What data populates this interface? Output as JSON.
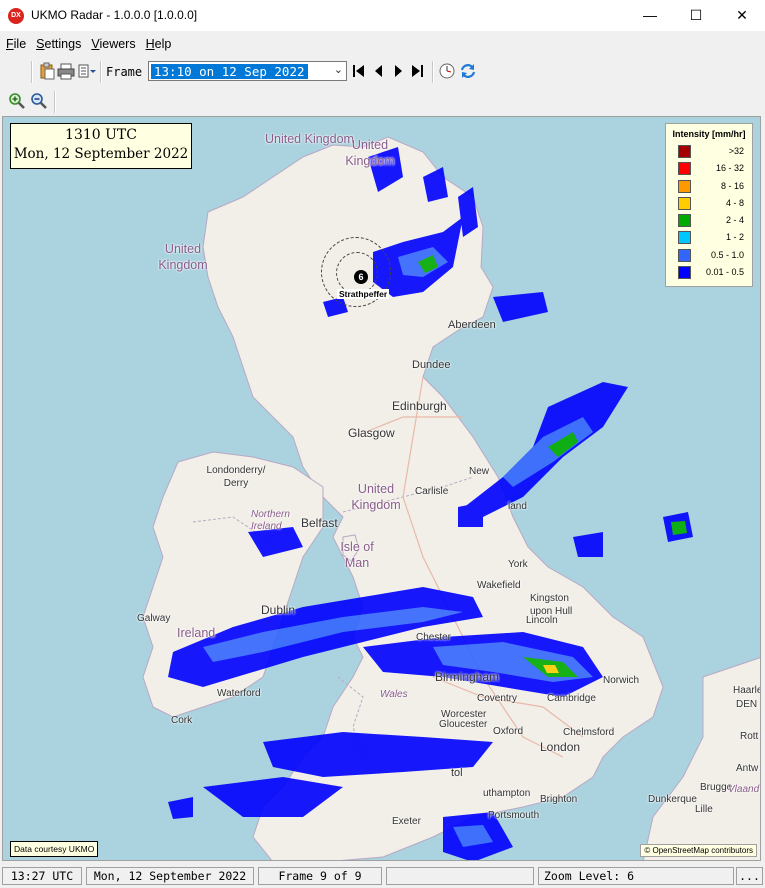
{
  "window": {
    "title": "UKMO Radar - 1.0.0.0 [1.0.0.0]",
    "icon_text": "DX",
    "minimize": "—",
    "maximize": "☐",
    "close": "✕"
  },
  "menu": [
    "File",
    "Settings",
    "Viewers",
    "Help"
  ],
  "toolbar": {
    "frame_label": "Frame",
    "frame_value": "13:10 on 12 Sep 2022"
  },
  "map": {
    "time_utc": "1310 UTC",
    "date_long": "Mon, 12 September 2022",
    "legend_title": "Intensity [mm/hr]",
    "legend": [
      {
        "label": ">32",
        "color": "#a50000"
      },
      {
        "label": "16 - 32",
        "color": "#ff0000"
      },
      {
        "label": "8 - 16",
        "color": "#ff9900"
      },
      {
        "label": "4 - 8",
        "color": "#ffcc00"
      },
      {
        "label": "2 - 4",
        "color": "#00aa00"
      },
      {
        "label": "1 - 2",
        "color": "#00c8ff"
      },
      {
        "label": "0.5 - 1.0",
        "color": "#3366ff"
      },
      {
        "label": "0.01 - 0.5",
        "color": "#0000ff"
      }
    ],
    "radar_site_number": "6",
    "radar_site_name": "Strathpeffer",
    "credit_left": "Data courtesy UKMO",
    "credit_right": "© OpenStreetMap contributors",
    "places": {
      "uk1": "United Kingdom",
      "uk2": "United Kingdom",
      "uk3": "United Kingdom",
      "aberdeen": "Aberdeen",
      "dundee": "Dundee",
      "edinburgh": "Edinburgh",
      "glasgow": "Glasgow",
      "londonderry": "Londonderry/ Derry",
      "northern_ireland": "Northern Ireland",
      "belfast": "Belfast",
      "isle_of_man": "Isle of Man",
      "carlisle": "Carlisle",
      "newcastle": "New",
      "york": "York",
      "wakefield": "Wakefield",
      "kingston": "Kingston upon Hull",
      "lincoln": "Lincoln",
      "chester": "Chester",
      "birmingham": "Birmingham",
      "coventry": "Coventry",
      "norwich": "Norwich",
      "cambridge": "Cambridge",
      "wales": "Wales",
      "worcester": "Worcester",
      "gloucester": "Gloucester",
      "oxford": "Oxford",
      "chelmsford": "Chelmsford",
      "london": "London",
      "dublin": "Dublin",
      "galway": "Galway",
      "ireland": "Ireland",
      "waterford": "Waterford",
      "cork": "Cork",
      "bristol": "tol",
      "southampton": "uthampton",
      "brighton": "Brighton",
      "portsmouth": "Portsmouth",
      "exeter": "Exeter",
      "dunkerque": "Dunkerque",
      "brugge": "Brugge",
      "lille": "Lille",
      "den": "DEN",
      "haarlem": "Haarle",
      "rotterdam": "Rott",
      "antwerp": "Antw",
      "vlaanderen": "Vlaand",
      "hand": "land"
    }
  },
  "status": {
    "time": "13:27 UTC",
    "date": "Mon, 12 September 2022",
    "frame": "Frame 9 of 9",
    "empty": "",
    "zoom": "Zoom Level: 6",
    "dots": "..."
  }
}
